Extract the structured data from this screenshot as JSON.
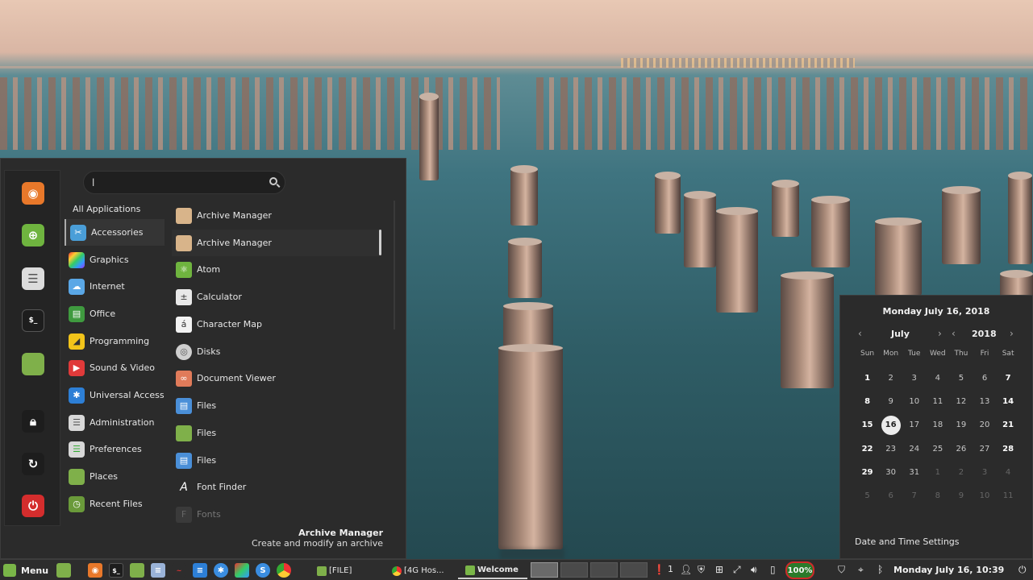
{
  "menu": {
    "search": {
      "value": "l",
      "placeholder": ""
    },
    "all_applications": "All Applications",
    "categories": [
      {
        "label": "Accessories",
        "icon": "accessories-icon",
        "selected": true
      },
      {
        "label": "Graphics",
        "icon": "graphics-icon"
      },
      {
        "label": "Internet",
        "icon": "internet-icon"
      },
      {
        "label": "Office",
        "icon": "office-icon"
      },
      {
        "label": "Programming",
        "icon": "programming-icon"
      },
      {
        "label": "Sound & Video",
        "icon": "sound-video-icon"
      },
      {
        "label": "Universal Access",
        "icon": "universal-access-icon"
      },
      {
        "label": "Administration",
        "icon": "administration-icon"
      },
      {
        "label": "Preferences",
        "icon": "preferences-icon"
      },
      {
        "label": "Places",
        "icon": "places-icon"
      },
      {
        "label": "Recent Files",
        "icon": "recent-files-icon"
      }
    ],
    "apps": [
      {
        "label": "Archive Manager",
        "icon": "archive-icon"
      },
      {
        "label": "Archive Manager",
        "icon": "archive-icon"
      },
      {
        "label": "Atom",
        "icon": "atom-icon"
      },
      {
        "label": "Calculator",
        "icon": "calculator-icon"
      },
      {
        "label": "Character Map",
        "icon": "character-map-icon"
      },
      {
        "label": "Disks",
        "icon": "disks-icon"
      },
      {
        "label": "Document Viewer",
        "icon": "document-viewer-icon"
      },
      {
        "label": "Files",
        "icon": "files-icon"
      },
      {
        "label": "Files",
        "icon": "folder-icon"
      },
      {
        "label": "Files",
        "icon": "files-icon"
      },
      {
        "label": "Font Finder",
        "icon": "font-finder-icon"
      },
      {
        "label": "Fonts",
        "icon": "fonts-icon"
      }
    ],
    "description": {
      "title": "Archive Manager",
      "text": "Create and modify an archive"
    },
    "favorites": [
      "firefox-icon",
      "software-manager-icon",
      "settings-icon",
      "terminal-icon",
      "files-icon"
    ],
    "session": [
      "lock-icon",
      "logout-icon",
      "power-icon"
    ]
  },
  "calendar": {
    "date": "Monday July 16, 2018",
    "month": "July",
    "year": "2018",
    "weekdays": [
      "Sun",
      "Mon",
      "Tue",
      "Wed",
      "Thu",
      "Fri",
      "Sat"
    ],
    "weeks": [
      [
        "1",
        "2",
        "3",
        "4",
        "5",
        "6",
        "7"
      ],
      [
        "8",
        "9",
        "10",
        "11",
        "12",
        "13",
        "14"
      ],
      [
        "15",
        "16",
        "17",
        "18",
        "19",
        "20",
        "21"
      ],
      [
        "22",
        "23",
        "24",
        "25",
        "26",
        "27",
        "28"
      ],
      [
        "29",
        "30",
        "31",
        "1",
        "2",
        "3",
        "4"
      ],
      [
        "5",
        "6",
        "7",
        "8",
        "9",
        "10",
        "11"
      ]
    ],
    "today": "16",
    "settings_label": "Date and Time Settings"
  },
  "taskbar": {
    "menu_label": "Menu",
    "windows": [
      {
        "label": "[FILE]",
        "icon": "folder-icon"
      },
      {
        "label": "[4G Hos...",
        "icon": "chrome-icon"
      },
      {
        "label": "Welcome",
        "icon": "mint-icon",
        "active": true
      }
    ],
    "notifications": "1",
    "battery": "100%",
    "clock": "Monday July 16, 10:39"
  }
}
